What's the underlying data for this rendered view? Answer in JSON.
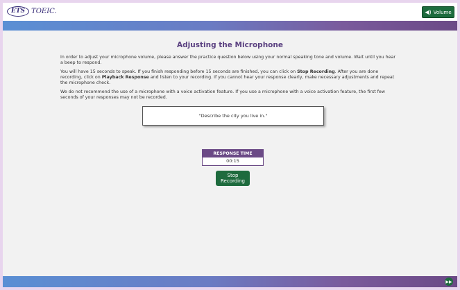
{
  "header": {
    "logo_badge": "ETS",
    "logo_text": "TOEIC.",
    "volume_label": "Volume"
  },
  "main": {
    "title": "Adjusting the Microphone",
    "paragraph1": "In order to adjust your microphone volume, please answer the practice question below using your normal speaking tone and volume. Wait until you hear a beep to respond.",
    "paragraph2_pre": "You will have 15 seconds to speak. If you finish responding before 15 seconds are finished, you can click on ",
    "paragraph2_bold1": "Stop Recording",
    "paragraph2_mid": ". After you are done recording, click on ",
    "paragraph2_bold2": "Playback Response",
    "paragraph2_post": " and listen to your recording. If you cannot hear your response clearly, make necessary adjustments and repeat the microphone check.",
    "paragraph3": "We do not recommend the use of a microphone with a voice activation feature. If you use a microphone with a voice activation feature, the first few seconds of your responses may not be recorded.",
    "question": "\"Describe the city you live in.\"",
    "response_label": "RESPONSE TIME",
    "response_time": "00:15",
    "stop_line1": "Stop",
    "stop_line2": "Recording"
  },
  "colors": {
    "accent_purple": "#6b4a86",
    "button_green": "#1e6b3e",
    "title_purple": "#5a4080"
  }
}
